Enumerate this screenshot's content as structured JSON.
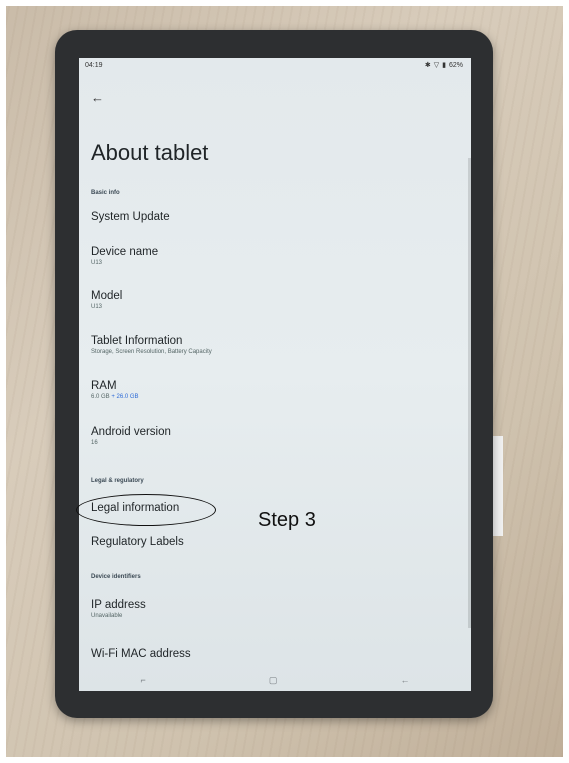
{
  "status": {
    "time": "04:19",
    "battery": "62%"
  },
  "page_title": "About tablet",
  "sections": {
    "basic_info": "Basic info",
    "legal": "Legal & regulatory",
    "device_ids": "Device identifiers"
  },
  "items": {
    "system_update": {
      "title": "System Update"
    },
    "device_name": {
      "title": "Device name",
      "sub": "U13"
    },
    "model": {
      "title": "Model",
      "sub": "U13"
    },
    "tablet_info": {
      "title": "Tablet Information",
      "sub": "Storage, Screen Resolution, Battery Capacity"
    },
    "ram": {
      "title": "RAM",
      "sub_base": "6.0 GB ",
      "sub_extra": "+ 26.0 GB"
    },
    "android": {
      "title": "Android version",
      "sub": "16"
    },
    "legal_info": {
      "title": "Legal information"
    },
    "regulatory": {
      "title": "Regulatory Labels"
    },
    "ip": {
      "title": "IP address",
      "sub": "Unavailable"
    },
    "wifi_mac": {
      "title": "Wi-Fi MAC address"
    }
  },
  "annotation": {
    "step": "Step 3"
  },
  "colors": {
    "accent": "#2d6ad6"
  },
  "icons": {
    "back": "back-arrow-icon",
    "nav_recents": "recents-icon",
    "nav_home": "home-icon",
    "nav_back": "back-icon"
  }
}
